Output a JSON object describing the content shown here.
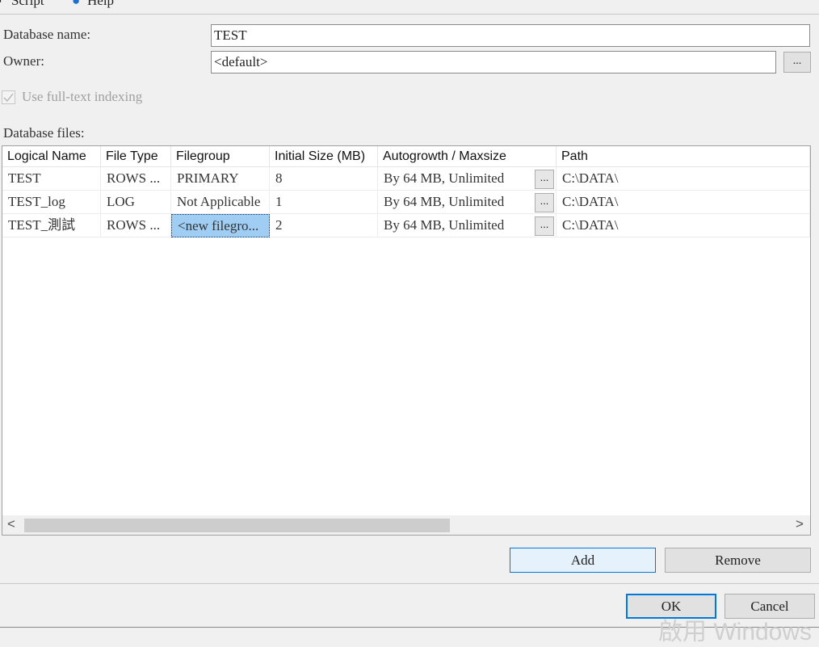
{
  "toolbar": {
    "script_label": "Script",
    "help_label": "Help"
  },
  "form": {
    "database_name_label": "Database name:",
    "database_name_value": "TEST",
    "owner_label": "Owner:",
    "owner_value": "<default>",
    "owner_browse": "...",
    "fulltext_label": "Use full-text indexing",
    "fulltext_checked": true,
    "fulltext_enabled": false,
    "files_label": "Database files:"
  },
  "grid": {
    "columns": [
      "Logical Name",
      "File Type",
      "Filegroup",
      "Initial Size (MB)",
      "Autogrowth / Maxsize",
      "Path"
    ],
    "rows": [
      {
        "logical_name": "TEST",
        "file_type": "ROWS ...",
        "filegroup": "PRIMARY",
        "initial_size": "8",
        "autogrowth": "By 64 MB, Unlimited",
        "browse": "...",
        "path": "C:\\DATA\\"
      },
      {
        "logical_name": "TEST_log",
        "file_type": "LOG",
        "filegroup": "Not Applicable",
        "initial_size": "1",
        "autogrowth": "By 64 MB, Unlimited",
        "browse": "...",
        "path": "C:\\DATA\\"
      },
      {
        "logical_name": "TEST_測試",
        "file_type": "ROWS ...",
        "filegroup": "<new filegro...",
        "initial_size": "2",
        "autogrowth": "By 64 MB, Unlimited",
        "browse": "...",
        "path": "C:\\DATA\\"
      }
    ],
    "scroll_left": "<",
    "scroll_right": ">"
  },
  "buttons": {
    "add": "Add",
    "remove": "Remove",
    "ok": "OK",
    "cancel": "Cancel"
  },
  "watermark": "啟用 Windows",
  "colors": {
    "selected_cell": "#9fcdf3",
    "add_button_bg": "#e5f1fb",
    "add_button_border": "#0078d7"
  }
}
